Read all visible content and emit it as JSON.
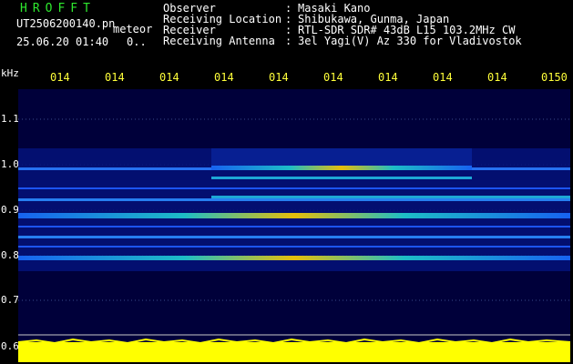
{
  "header": {
    "brand": "HROFFT",
    "filename": "UT2506200140.pn",
    "filename_suffix": "meteor",
    "datetime": "25.06.20 01:40",
    "datetime_extra": "0.."
  },
  "info": [
    {
      "label": "Observer",
      "sep": ":",
      "value": "Masaki Kano"
    },
    {
      "label": "Receiving Location",
      "sep": ":",
      "value": "Shibukawa, Gunma, Japan"
    },
    {
      "label": "Receiver",
      "sep": ":",
      "value": "RTL-SDR SDR# 43dB L15 103.2MHz CW"
    },
    {
      "label": "Receiving Antenna",
      "sep": ":",
      "value": "3el Yagi(V) Az 330 for Vladivostok"
    }
  ],
  "axis": {
    "unit": "kHz",
    "y_ticks": [
      "1.1",
      "1.0",
      "0.9",
      "0.8",
      "0.7",
      "0.6"
    ],
    "time_ticks": [
      "014",
      "014",
      "014",
      "014",
      "014",
      "014",
      "014",
      "014",
      "014",
      "0150"
    ]
  },
  "colors": {
    "header_brand": "#2ee82e",
    "tick_text": "#ffff3a",
    "plot_bg": "#00003a",
    "signal": "#ffff00"
  }
}
